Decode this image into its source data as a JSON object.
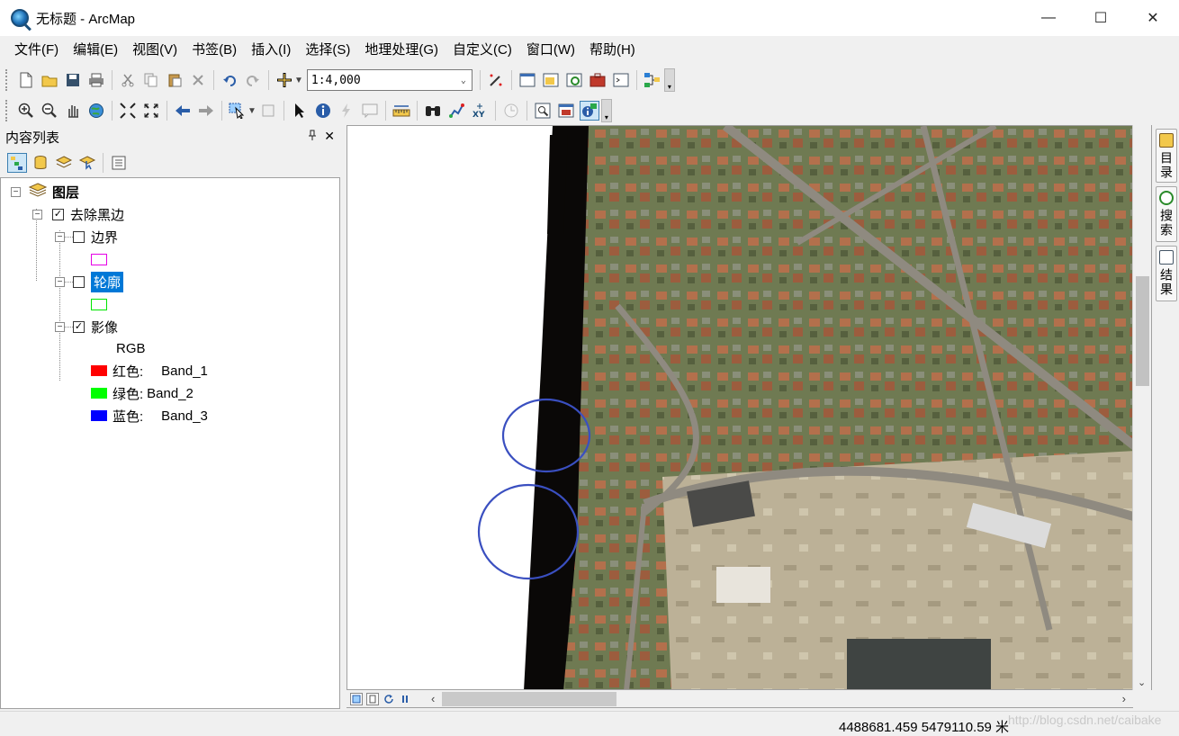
{
  "window": {
    "title": "无标题 - ArcMap",
    "controls": [
      "—",
      "☐",
      "✕"
    ]
  },
  "menu": [
    "文件(F)",
    "编辑(E)",
    "视图(V)",
    "书签(B)",
    "插入(I)",
    "选择(S)",
    "地理处理(G)",
    "自定义(C)",
    "窗口(W)",
    "帮助(H)"
  ],
  "toolbar": {
    "scale_value": "1:4,000"
  },
  "toc": {
    "title": "内容列表",
    "pin": "ꟷ",
    "close": "✕",
    "root": "图层",
    "group": "去除黑边",
    "layers": [
      {
        "name": "边界",
        "checked": false,
        "symbol_color": "#e600e6"
      },
      {
        "name": "轮廓",
        "checked": false,
        "symbol_color": "#00e600"
      },
      {
        "name": "影像",
        "checked": true
      }
    ],
    "raster_legend_title": "RGB",
    "bands": [
      {
        "label": "红色:",
        "band": "Band_1",
        "color": "#ff0000"
      },
      {
        "label": "绿色:",
        "band": "Band_2",
        "color": "#00ff00"
      },
      {
        "label": "蓝色:",
        "band": "Band_3",
        "color": "#0000ff"
      }
    ]
  },
  "dock": [
    "目录",
    "搜索",
    "结果"
  ],
  "status": {
    "coordinates": "4488681.459  5479110.59 米",
    "watermark": "http://blog.csdn.net/caibake"
  }
}
